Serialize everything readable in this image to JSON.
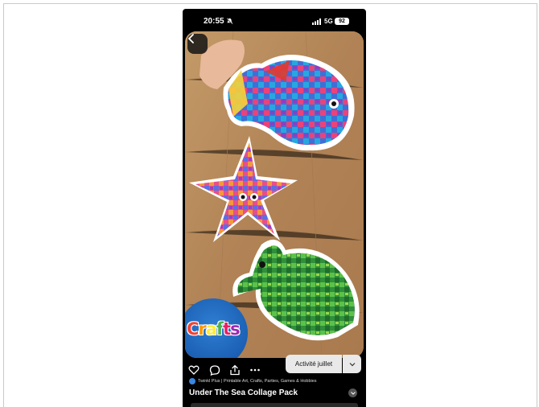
{
  "status_bar": {
    "time": "20:55",
    "network": "5G",
    "battery": "92"
  },
  "media": {
    "badge_text": "Crafts",
    "badge_colors": [
      "#f44336",
      "#ff9800",
      "#ffeb3b",
      "#4caf50",
      "#e91e63",
      "#9c27b0"
    ]
  },
  "actions": {
    "like_icon": "heart-icon",
    "comment_icon": "comment-icon",
    "share_icon": "share-icon",
    "more_icon": "more-icon",
    "board_button_label": "Activité juillet"
  },
  "pin": {
    "source": "Twinkl Plus | Printable Art, Crafts, Parties, Games & Hobbies",
    "title": "Under The Sea Collage Pack"
  },
  "colors": {
    "background": "#000000",
    "button": "#e9e9e9",
    "wood": "#b58c5b"
  }
}
